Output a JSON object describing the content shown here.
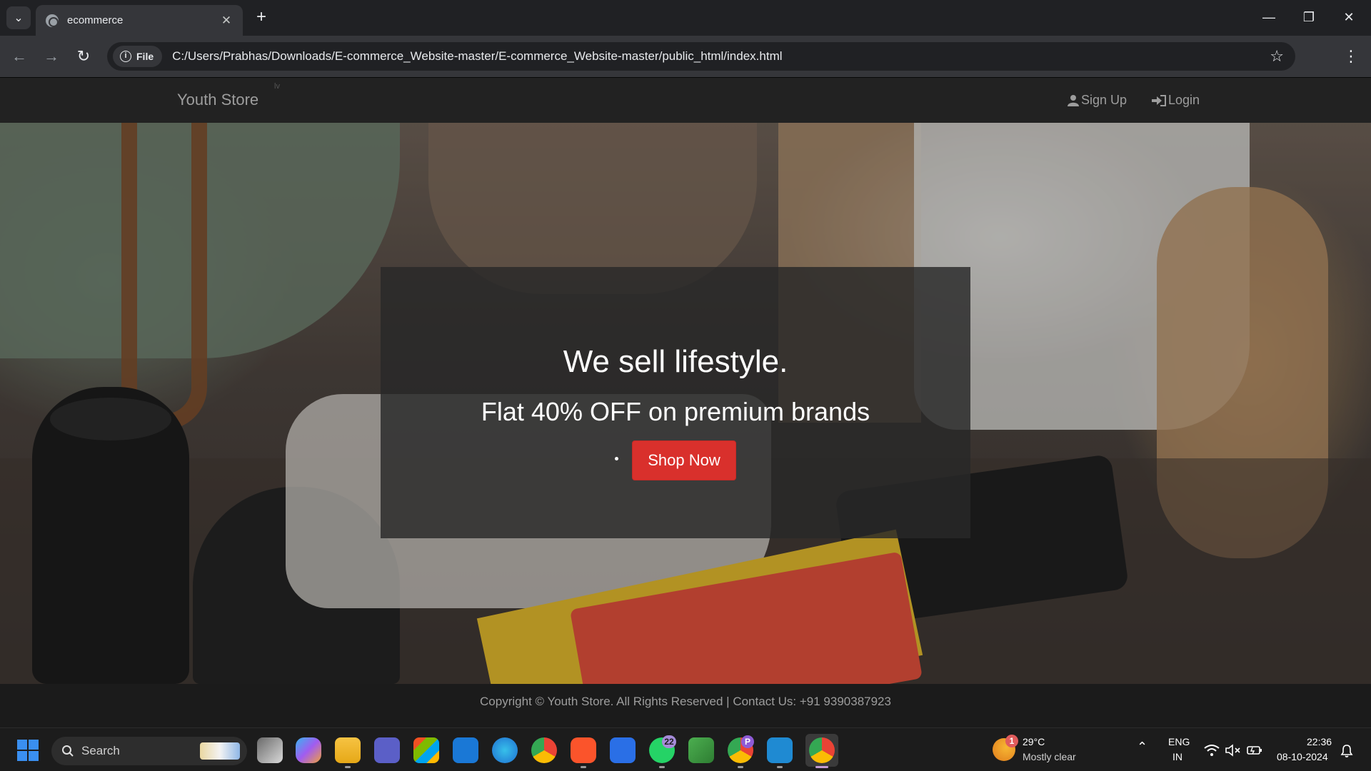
{
  "browser": {
    "tab_title": "ecommerce",
    "new_tab_label": "+",
    "site_chip": "File",
    "url": "C:/Users/Prabhas/Downloads/E-commerce_Website-master/E-commerce_Website-master/public_html/index.html"
  },
  "site": {
    "brand": "Youth Store",
    "brand_mark": "lv",
    "nav": {
      "signup": "Sign Up",
      "login": "Login"
    },
    "hero": {
      "title": "We sell lifestyle.",
      "subtitle": "Flat 40% OFF on premium brands",
      "cta": "Shop Now"
    },
    "footer": "Copyright © Youth Store. All Rights Reserved | Contact Us: +91 9390387923"
  },
  "taskbar": {
    "search_label": "Search",
    "whatsapp_badge": "22",
    "chrome_profile_badge": "P",
    "weather": {
      "badge": "1",
      "temp": "29°C",
      "condition": "Mostly clear"
    },
    "lang_primary": "ENG",
    "lang_secondary": "IN",
    "time": "22:36",
    "date": "08-10-2024"
  },
  "colors": {
    "accent_button": "#d9302c",
    "navbar_bg": "#222222",
    "footer_bg": "#1b1b1b",
    "nav_text": "#9d9d9d"
  }
}
